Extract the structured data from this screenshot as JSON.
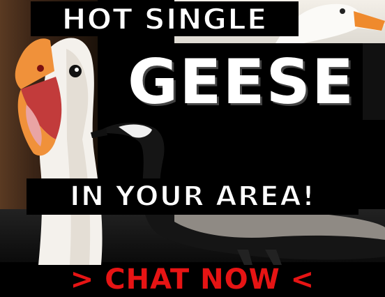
{
  "headline_top": "HOT SINGLE",
  "headline_main": "GEESE",
  "headline_sub": "IN YOUR AREA!",
  "cta": "> CHAT NOW <",
  "colors": {
    "background": "#000000",
    "headline_text": "#ffffff",
    "cta_text": "#e61414"
  }
}
